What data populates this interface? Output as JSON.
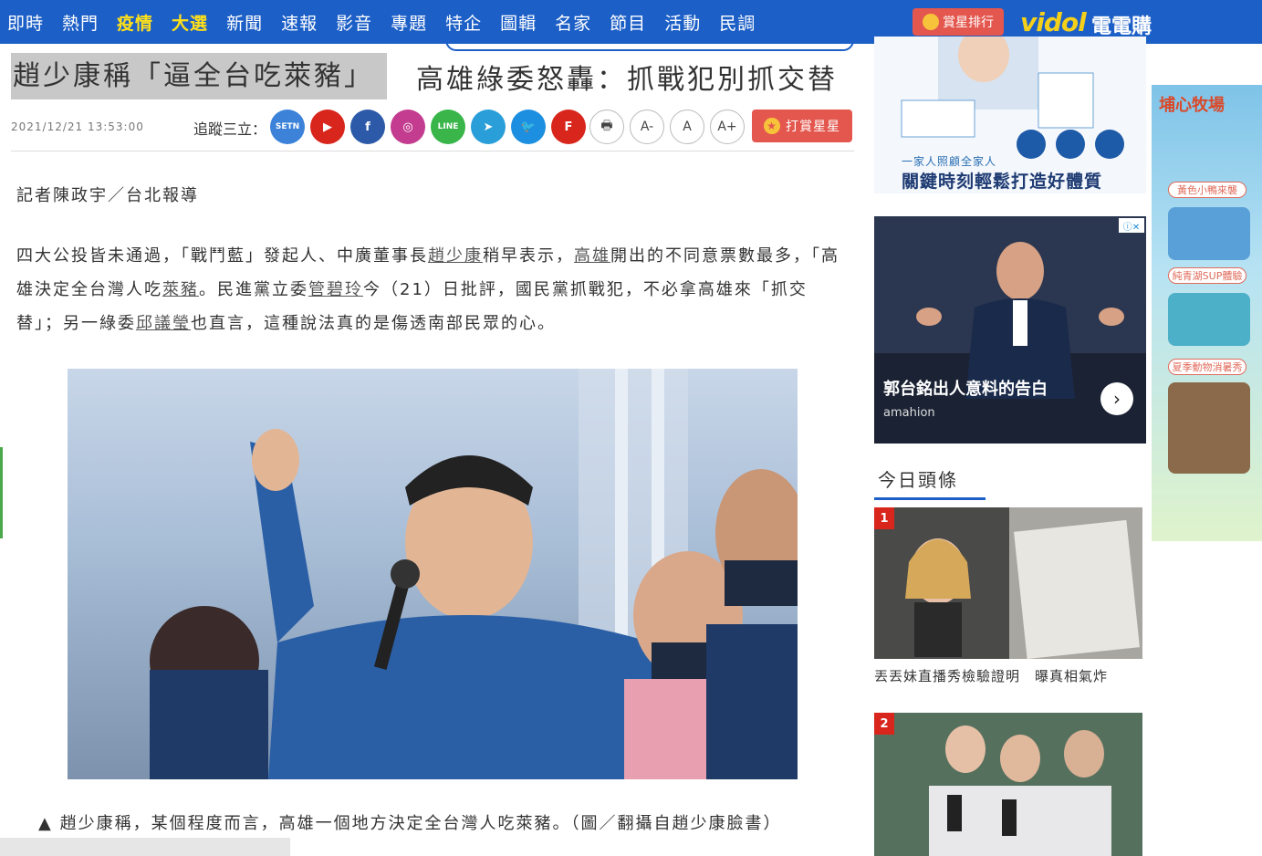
{
  "nav": {
    "items": [
      "即時",
      "熱門",
      "疫情",
      "大選",
      "新聞",
      "速報",
      "影音",
      "專題",
      "特企",
      "圖輯",
      "名家",
      "節目",
      "活動",
      "民調"
    ],
    "hot_items": [
      "疫情",
      "大選"
    ],
    "rank_label": "賞星排行",
    "vidol_label": "vidol",
    "ddg_label": "電電購"
  },
  "article": {
    "headline_part1": "趙少康稱「逼全台吃萊豬」",
    "headline_part2": "高雄綠委怒轟：抓戰犯別抓交替",
    "date": "2021/12/21 13:53:00",
    "follow_label": "追蹤三立：",
    "star_label": "打賞星星",
    "byline": "記者陳政宇／台北報導",
    "lead_segments": [
      {
        "text": "四大公投皆未通過，「戰鬥藍」發起人、中廣董事長"
      },
      {
        "text": "趙少康",
        "link": true
      },
      {
        "text": "稍早表示，"
      },
      {
        "text": "高雄",
        "link": true
      },
      {
        "text": "開出的不同意票數最多，「高雄決定全台灣人吃"
      },
      {
        "text": "萊豬",
        "link": true
      },
      {
        "text": "。民進黨立委"
      },
      {
        "text": "管碧玲",
        "link": true
      },
      {
        "text": "今（21）日批評，國民黨抓戰犯，不必拿高雄來「抓交替」；另一綠委"
      },
      {
        "text": "邱議瑩",
        "link": true
      },
      {
        "text": "也直言，這種說法真的是傷透南部民眾的心。"
      }
    ],
    "caption": "▲ 趙少康稱，某個程度而言，高雄一個地方決定全台灣人吃萊豬。（圖／翻攝自趙少康臉書）"
  },
  "social": [
    {
      "name": "setn-icon",
      "label": "SETN",
      "color": "#3b82d8"
    },
    {
      "name": "youtube-icon",
      "label": "▶",
      "color": "#d8261c"
    },
    {
      "name": "facebook-icon",
      "label": "f",
      "color": "#2c5aa8"
    },
    {
      "name": "instagram-icon",
      "label": "◎",
      "color": "#c33c8f"
    },
    {
      "name": "line-icon",
      "label": "LINE",
      "color": "#39b54a"
    },
    {
      "name": "telegram-icon",
      "label": "➤",
      "color": "#2a9ed8"
    },
    {
      "name": "twitter-icon",
      "label": "🐦",
      "color": "#1d8fe0"
    },
    {
      "name": "flipboard-icon",
      "label": "F",
      "color": "#d8261c"
    }
  ],
  "tools": {
    "print": "🖶",
    "font_minus": "A-",
    "font_normal": "A",
    "font_plus": "A+"
  },
  "ads": {
    "top_slogan1": "一家人照顧全家人",
    "top_slogan2": "關鍵時刻輕鬆打造好體質",
    "mid_title": "郭台銘出人意料的告白",
    "mid_source": "amahion",
    "adchoice": "ⓘ✕",
    "side_brand": "埔心牧場",
    "side_tags": [
      "黃色小鴨來襲",
      "純青湖SUP體驗",
      "夏季動物消暑秀"
    ]
  },
  "today": {
    "title": "今日頭條",
    "items": [
      {
        "rank": "1",
        "caption": "丟丟妹直播秀檢驗證明　曝真相氣炸"
      },
      {
        "rank": "2",
        "caption": ""
      }
    ]
  }
}
